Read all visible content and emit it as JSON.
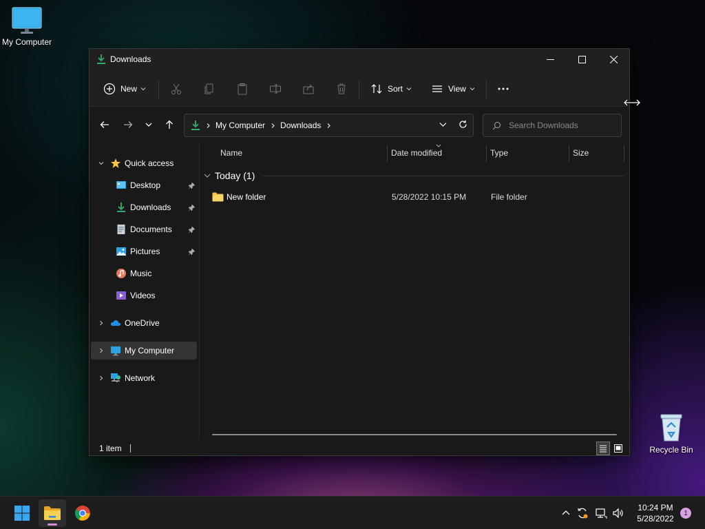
{
  "desktop": {
    "icons": [
      {
        "label": "My Computer"
      },
      {
        "label": "Recycle Bin"
      }
    ]
  },
  "window": {
    "title": "Downloads",
    "toolbar": {
      "new_label": "New",
      "sort_label": "Sort",
      "view_label": "View"
    },
    "address": {
      "crumbs": [
        "My Computer",
        "Downloads"
      ]
    },
    "search": {
      "placeholder": "Search Downloads"
    },
    "sidebar": {
      "quick_access": "Quick access",
      "items": [
        {
          "label": "Desktop",
          "pinned": true
        },
        {
          "label": "Downloads",
          "pinned": true
        },
        {
          "label": "Documents",
          "pinned": true
        },
        {
          "label": "Pictures",
          "pinned": true
        },
        {
          "label": "Music",
          "pinned": false
        },
        {
          "label": "Videos",
          "pinned": false
        }
      ],
      "onedrive": "OneDrive",
      "my_computer": "My Computer",
      "network": "Network"
    },
    "columns": {
      "name": "Name",
      "date_modified": "Date modified",
      "type": "Type",
      "size": "Size"
    },
    "group": {
      "label": "Today (1)"
    },
    "files": [
      {
        "name": "New folder",
        "date": "5/28/2022 10:15 PM",
        "type": "File folder",
        "size": ""
      }
    ],
    "status": {
      "count": "1 item"
    }
  },
  "taskbar": {
    "clock_time": "10:24 PM",
    "clock_date": "5/28/2022",
    "notification_count": "1"
  },
  "colors": {
    "accent_download": "#2fb36b",
    "folder_yellow": "#f5c542",
    "window_bg": "#191919",
    "chrome_bg": "#202020"
  }
}
